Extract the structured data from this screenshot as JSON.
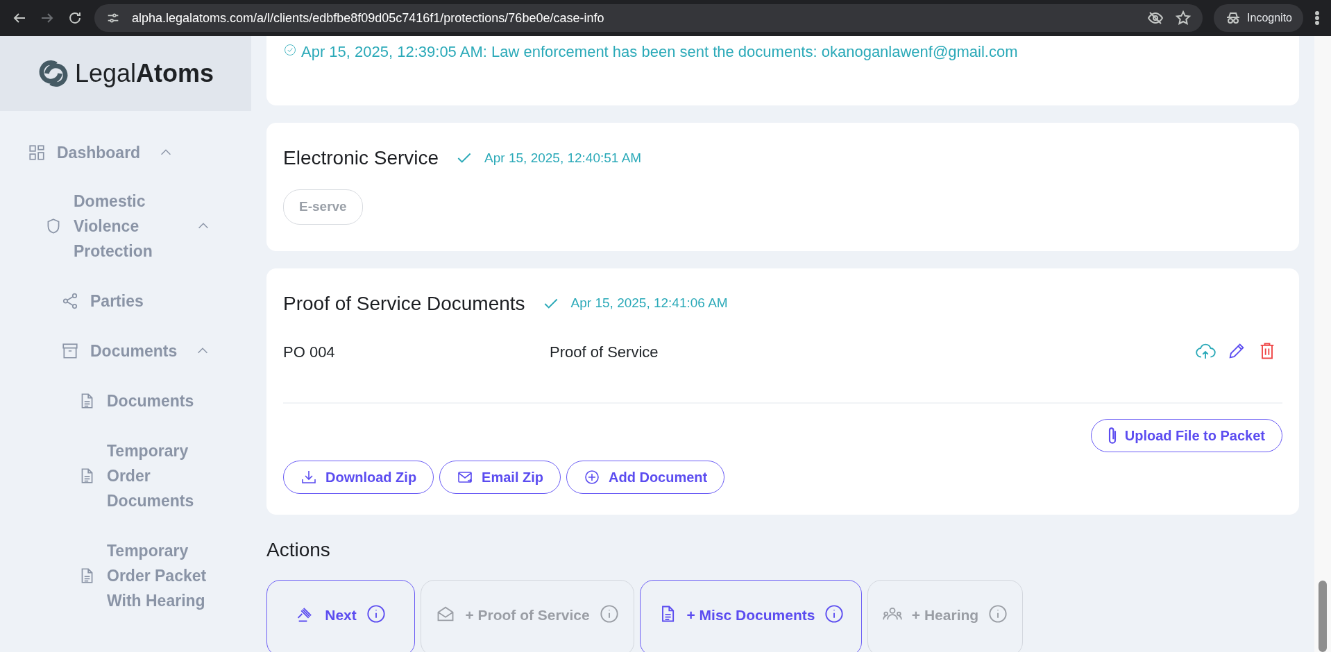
{
  "browser": {
    "url": "alpha.legalatoms.com/a/l/clients/edbfbe8f09d05c7416f1/protections/76be0e/case-info",
    "profile": "Incognito"
  },
  "sidebar": {
    "logo": "Legal**Atoms**",
    "items": [
      {
        "label": "Dashboard",
        "kind": "grid",
        "expanded": true,
        "children": [
          {
            "label": "Domestic Violence Protection",
            "kind": "shield",
            "expanded": true,
            "children": [
              {
                "label": "Parties",
                "kind": "share"
              },
              {
                "label": "Documents",
                "kind": "archive",
                "expanded": true,
                "children": [
                  {
                    "label": "Documents",
                    "kind": "file"
                  },
                  {
                    "label": "Temporary Order Documents",
                    "kind": "file"
                  },
                  {
                    "label": "Temporary Order Packet With Hearing",
                    "kind": "file"
                  }
                ]
              }
            ]
          }
        ]
      }
    ]
  },
  "log_line": "Apr 15, 2025, 12:39:05 AM: Law enforcement has been sent the documents: okanoganlawenf@gmail.com",
  "cards": [
    {
      "title": "Electronic Service",
      "done": true,
      "timestamp": "Apr 15, 2025, 12:40:51 AM",
      "tags": [
        "E-serve"
      ]
    },
    {
      "title": "Proof of Service Documents",
      "done": true,
      "timestamp": "Apr 15, 2025, 12:41:06 AM",
      "documents": [
        {
          "code": "PO 004",
          "name": "Proof of Service"
        }
      ],
      "upload_button": "Upload File to Packet",
      "buttons": [
        {
          "label": "Download Zip",
          "kind": "download"
        },
        {
          "label": "Email Zip",
          "kind": "mail"
        },
        {
          "label": "Add Document",
          "kind": "plus"
        }
      ]
    }
  ],
  "actions": {
    "title": "Actions",
    "items": [
      {
        "label": "Next",
        "kind": "gavel",
        "disabled": false
      },
      {
        "label": "+ Proof of Service",
        "kind": "envelope",
        "disabled": true
      },
      {
        "label": "+ Misc Documents",
        "kind": "file",
        "disabled": false
      },
      {
        "label": "+ Hearing",
        "kind": "people",
        "disabled": true
      }
    ]
  }
}
